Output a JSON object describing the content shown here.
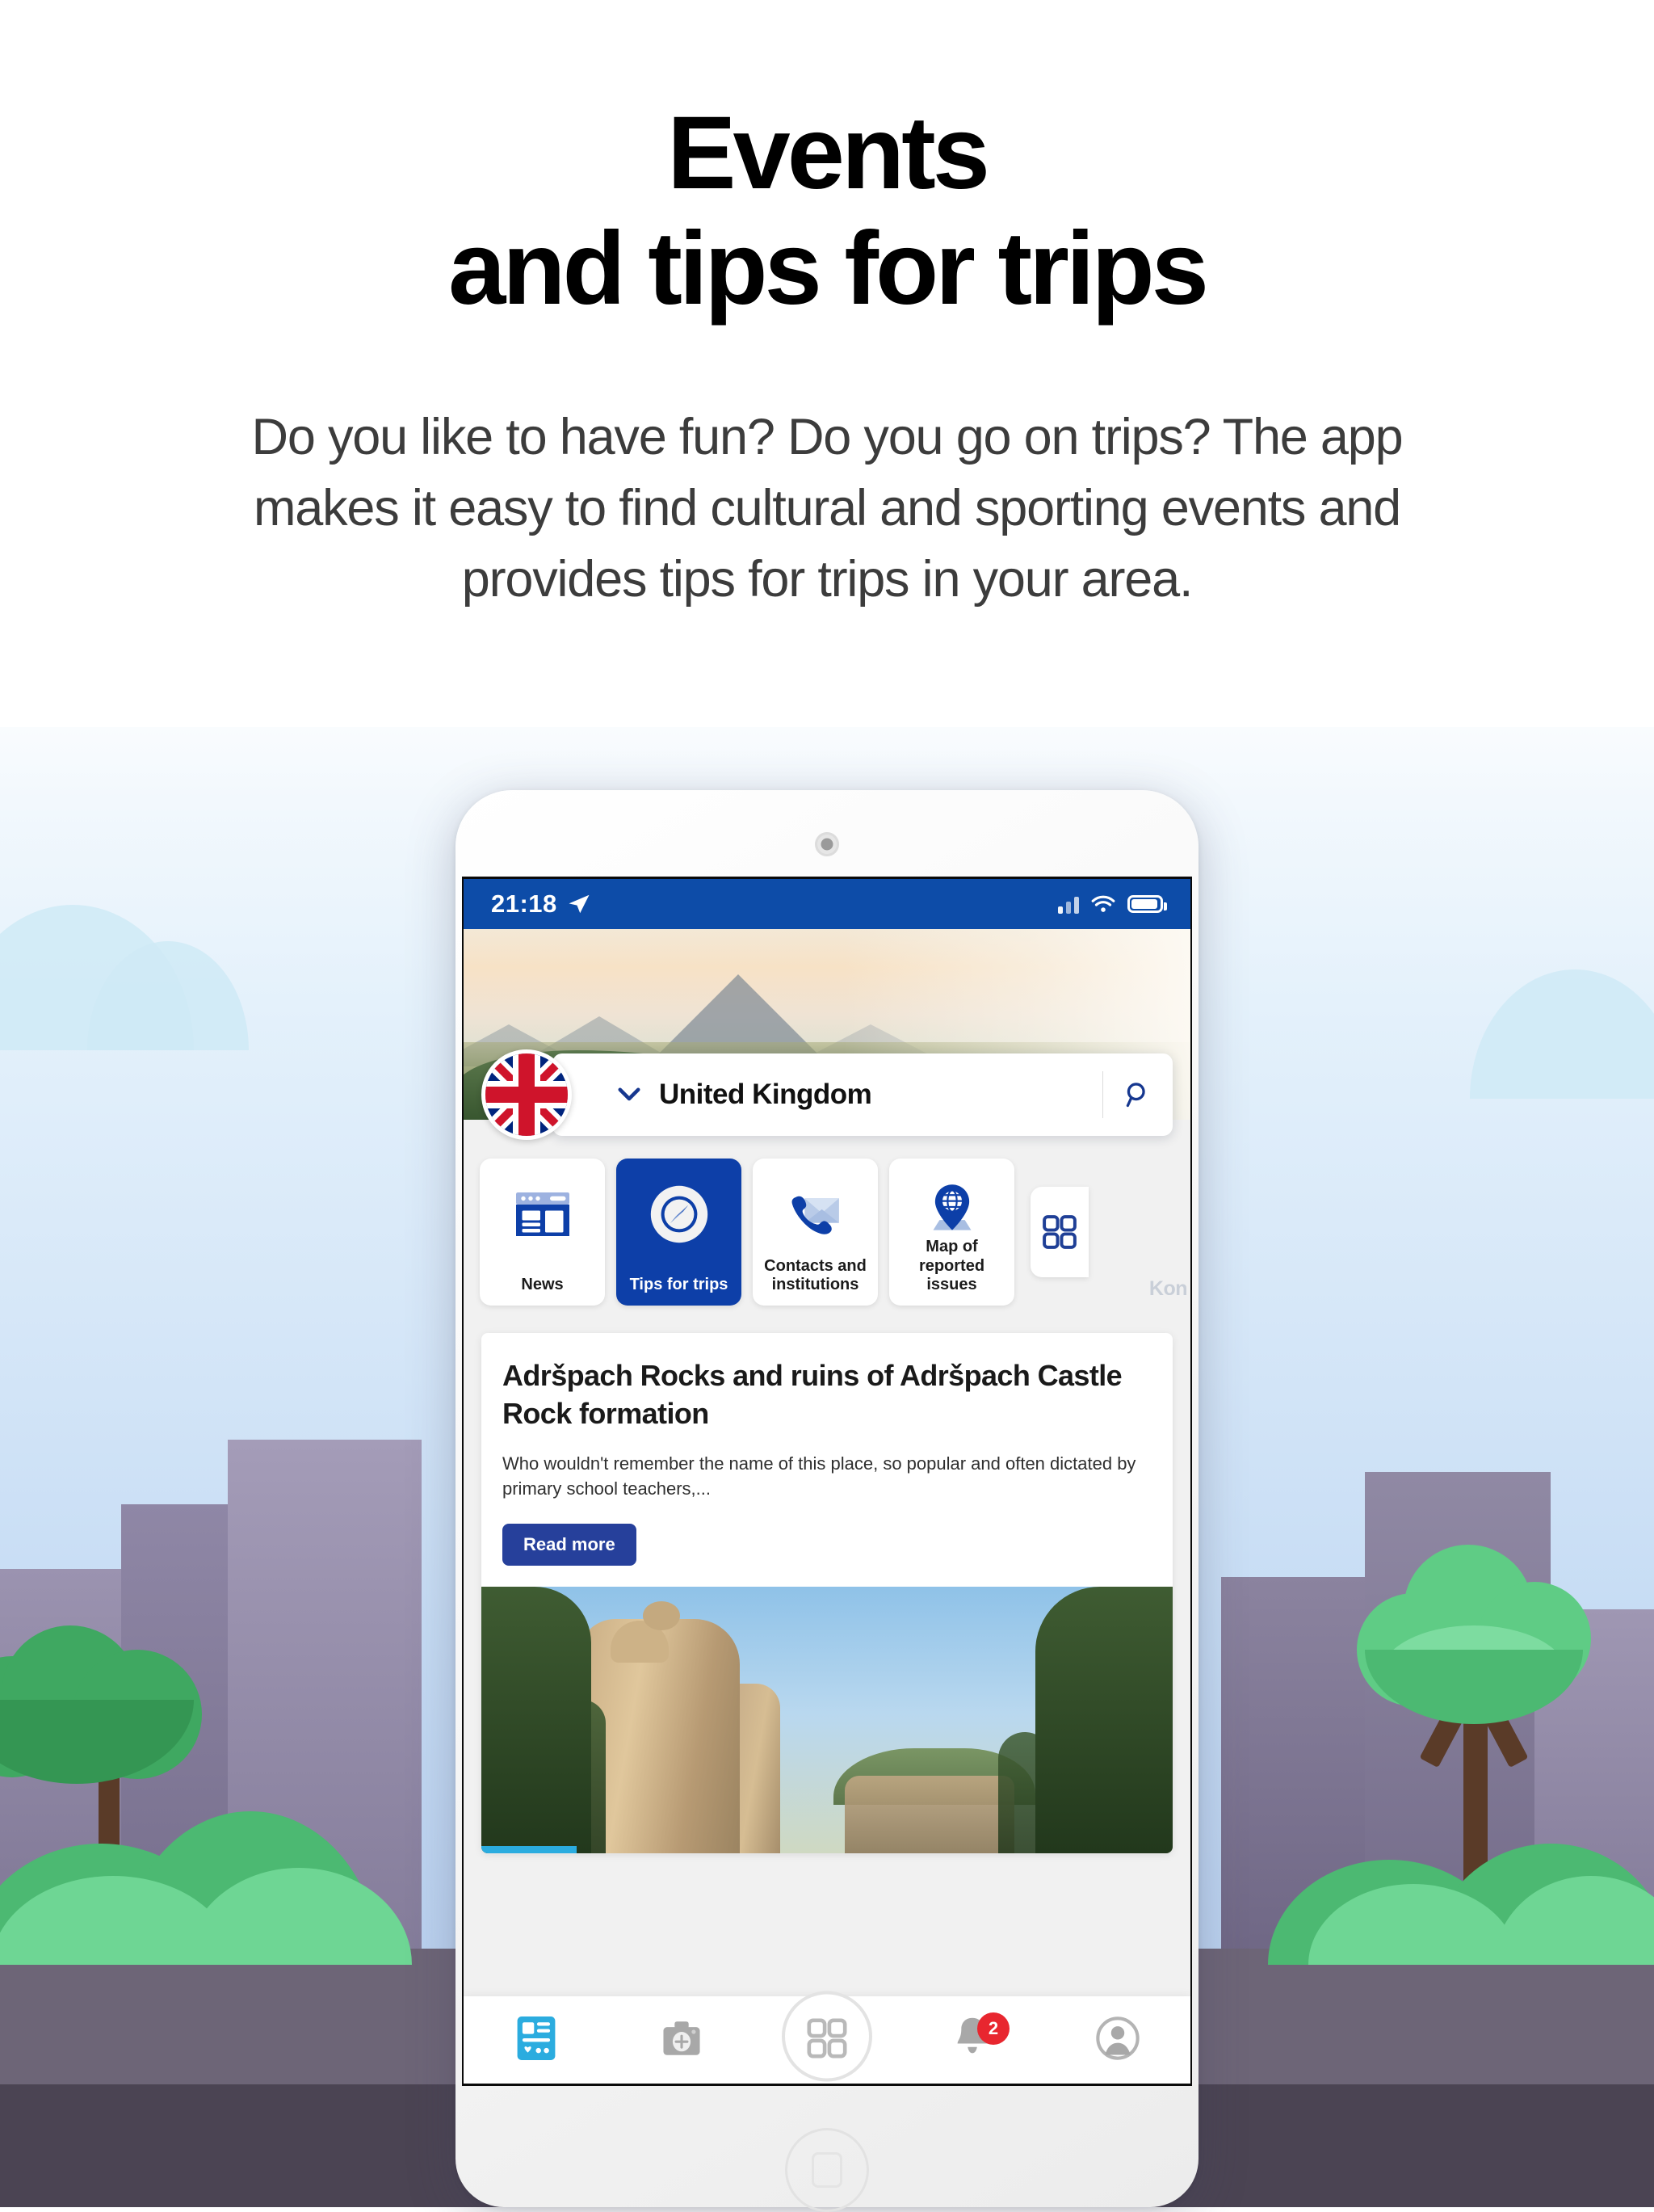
{
  "page": {
    "headline_line1": "Events",
    "headline_line2": "and tips for trips",
    "subhead_line1": "Do you like to have fun? Do you go on trips? The app",
    "subhead_line2": "makes it easy to find cultural and sporting events and",
    "subhead_line3": "provides tips for trips in your area."
  },
  "phone": {
    "statusbar": {
      "time": "21:18",
      "location_icon": "location-arrow-icon",
      "signal_icon": "signal-bars-icon",
      "wifi_icon": "wifi-icon",
      "battery_icon": "battery-icon"
    },
    "selector": {
      "flag": "united-kingdom-flag",
      "chevron": "chevron-down-icon",
      "country": "United Kingdom",
      "search_icon": "search-icon"
    },
    "tiles": [
      {
        "label": "News",
        "icon": "news-layout-icon",
        "active": false
      },
      {
        "label": "Tips for trips",
        "icon": "compass-icon",
        "active": true
      },
      {
        "label": "Contacts and institutions",
        "icon": "phone-envelope-icon",
        "active": false
      },
      {
        "label": "Map of reported issues",
        "icon": "map-pin-globe-icon",
        "active": false
      },
      {
        "label": "",
        "icon": "grid-apps-icon",
        "active": false
      }
    ],
    "ghost_label": "Kon",
    "article": {
      "title": "Adršpach Rocks and ruins of Adršpach Castle Rock formation",
      "body": "Who wouldn't remember the name of this place, so popular and often dictated by primary school teachers,...",
      "button": "Read more",
      "photo_alt": "adrspach-rock-formation-photo"
    },
    "bottomnav": [
      {
        "name": "news-feed-icon",
        "badge": ""
      },
      {
        "name": "camera-add-icon",
        "badge": ""
      },
      {
        "name": "apps-grid-icon",
        "badge": ""
      },
      {
        "name": "notifications-bell-icon",
        "badge": "2"
      },
      {
        "name": "profile-avatar-icon",
        "badge": ""
      }
    ]
  },
  "colors": {
    "brand_blue": "#0d4ca8",
    "tile_active": "#0d3fa8",
    "button_blue": "#26409b",
    "badge_red": "#e8262f",
    "accent_cyan": "#2bacdf"
  }
}
